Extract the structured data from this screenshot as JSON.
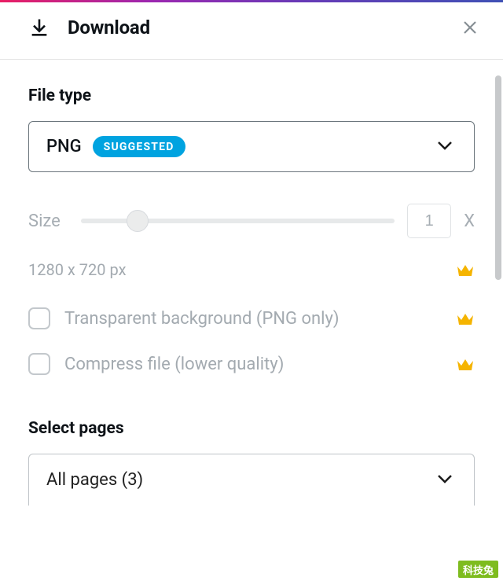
{
  "header": {
    "title": "Download"
  },
  "filetype": {
    "label": "File type",
    "value": "PNG",
    "badge": "SUGGESTED"
  },
  "size": {
    "label": "Size",
    "value": "1",
    "unit": "X",
    "dimensions": "1280 x 720 px"
  },
  "options": {
    "transparent": "Transparent background (PNG only)",
    "compress": "Compress file (lower quality)"
  },
  "pages": {
    "label": "Select pages",
    "value": "All pages (3)"
  },
  "watermark": "科技兔"
}
